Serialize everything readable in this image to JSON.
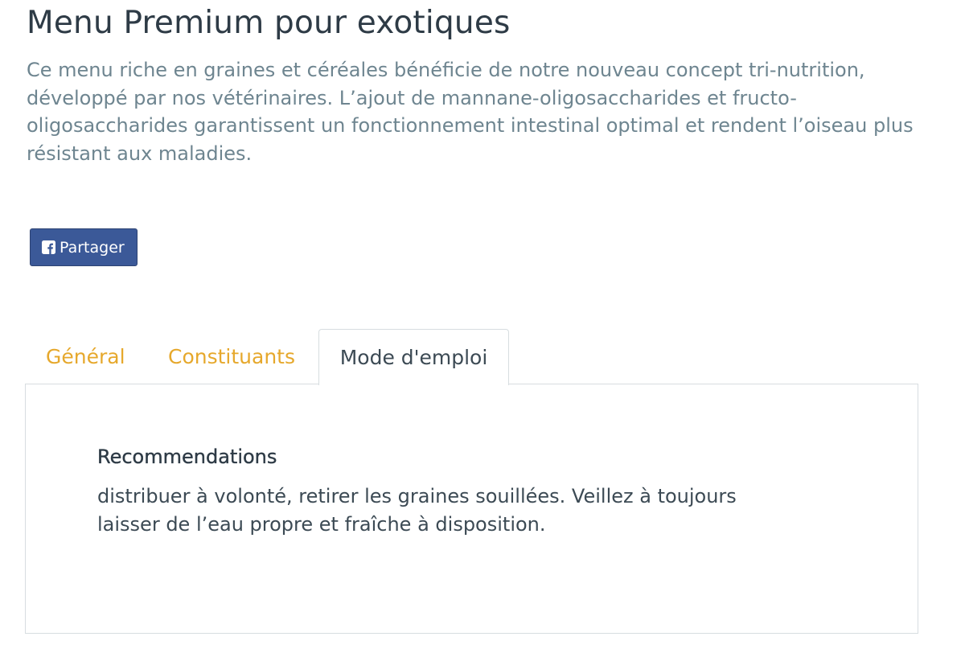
{
  "product": {
    "title": "Menu Premium pour exotiques",
    "description": "Ce menu riche en graines et céréales bénéficie de notre nouveau concept tri-nutrition, développé par nos vétérinaires. L’ajout de mannane-oligosaccharides et fructo-oligosaccharides garantissent un fonctionnement intestinal optimal et rendent l’oiseau plus résistant aux maladies."
  },
  "share": {
    "label": "Partager",
    "icon": "facebook-icon",
    "color": "#3b5998"
  },
  "tabs": [
    {
      "label": "Général",
      "active": false
    },
    {
      "label": "Constituants",
      "active": false
    },
    {
      "label": "Mode d'emploi",
      "active": true
    }
  ],
  "panel": {
    "heading": "Recommendations",
    "text": "distribuer à volonté, retirer les graines souillées. Veillez à toujours laisser de l’eau propre et fraîche à disposition."
  },
  "colors": {
    "title": "#2e3b46",
    "description": "#6e8590",
    "tab_inactive": "#e6a82c",
    "tab_active": "#3c4a54",
    "border": "#d7dde0"
  }
}
